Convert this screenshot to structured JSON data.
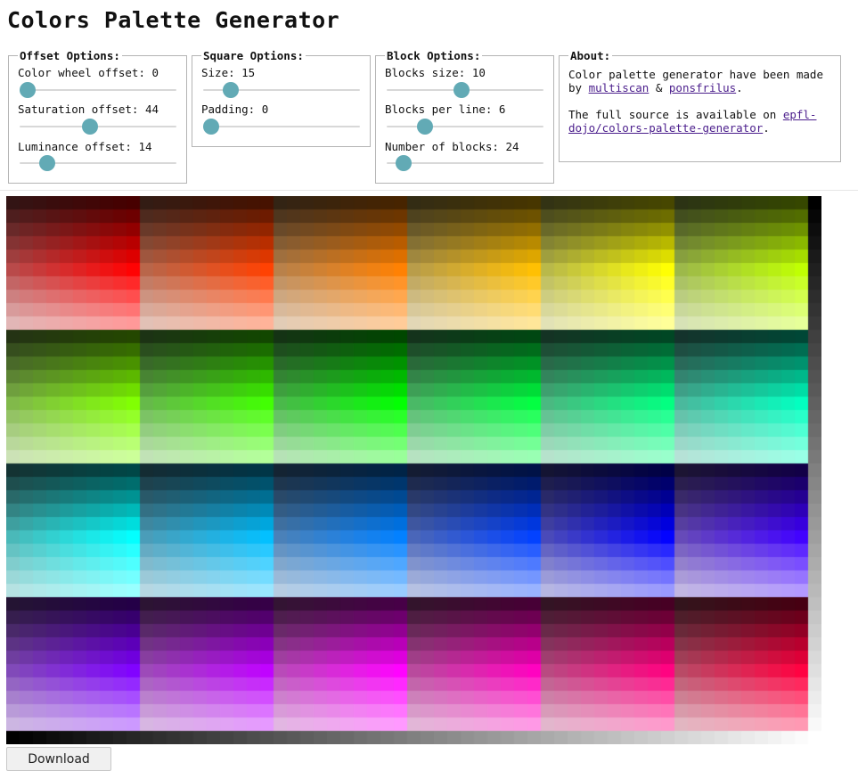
{
  "title": "Colors Palette Generator",
  "offset_options": {
    "legend": "Offset Options:",
    "controls": [
      {
        "label": "Color wheel offset: 0",
        "value": 0,
        "min": 0,
        "max": 360
      },
      {
        "label": "Saturation offset: 44",
        "value": 44,
        "min": 0,
        "max": 100
      },
      {
        "label": "Luminance offset: 14",
        "value": 14,
        "min": 0,
        "max": 100
      }
    ]
  },
  "square_options": {
    "legend": "Square Options:",
    "controls": [
      {
        "label": "Size: 15",
        "value": 15,
        "min": 1,
        "max": 100
      },
      {
        "label": "Padding: 0",
        "value": 0,
        "min": 0,
        "max": 50
      }
    ]
  },
  "block_options": {
    "legend": "Block Options:",
    "controls": [
      {
        "label": "Blocks size: 10",
        "value": 10,
        "min": 1,
        "max": 20
      },
      {
        "label": "Blocks per line: 6",
        "value": 6,
        "min": 1,
        "max": 24
      },
      {
        "label": "Number of blocks: 24",
        "value": 24,
        "min": 1,
        "max": 360
      }
    ]
  },
  "about": {
    "legend": "About:",
    "line1_prefix": "Color palette generator have been made by ",
    "author1": "multiscan",
    "and": " & ",
    "author2": "ponsfrilus",
    "period": ".",
    "line2_prefix": "The full source is available on ",
    "repo": "epfl-dojo/colors-palette-generator"
  },
  "palette": {
    "blocks_size": 10,
    "blocks_per_line": 6,
    "number_of_blocks": 24,
    "square_size": 15,
    "padding": 0,
    "color_wheel_offset": 0,
    "saturation_offset": 44,
    "luminance_offset": 14
  },
  "download_label": "Download"
}
